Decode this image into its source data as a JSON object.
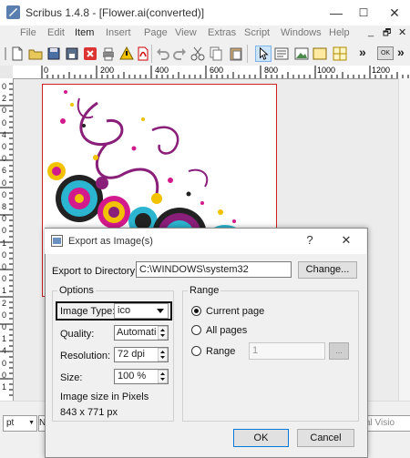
{
  "window": {
    "title": "Scribus 1.4.8 - [Flower.ai(converted)]",
    "controls": {
      "minimize": "—",
      "maximize": "☐",
      "close": "✕"
    }
  },
  "menubar": {
    "items": [
      "File",
      "Edit",
      "Item",
      "Insert",
      "Page",
      "View",
      "Extras",
      "Script",
      "Windows",
      "Help"
    ],
    "child_controls": {
      "minimize": "_",
      "restore": "🗗",
      "close": "✕"
    }
  },
  "toolbar": {
    "more": "»",
    "ok_label": "OK"
  },
  "ruler": {
    "h_labels": [
      "0",
      "200",
      "400",
      "600",
      "800",
      "1000",
      "1200"
    ],
    "v_labels": [
      "0",
      "2",
      "0",
      "0",
      "4",
      "0",
      "0",
      "6",
      "0",
      "0",
      "8",
      "0",
      "0",
      "1",
      "0",
      "0",
      "0",
      "1",
      "2",
      "0",
      "0",
      "1",
      "4",
      "0",
      "0",
      "1"
    ]
  },
  "statusbar": {
    "unit": "pt",
    "unit_arrow": "▼",
    "n_label": "N",
    "visio": "al Visio"
  },
  "dialog": {
    "title": "Export as Image(s)",
    "help": "?",
    "close": "✕",
    "dir_label": "Export to Directory:",
    "dir_value": "C:\\WINDOWS\\system32",
    "change_button": "Change...",
    "options_title": "Options",
    "image_type_label": "Image Type:",
    "image_type_value": "ico",
    "quality_label": "Quality:",
    "quality_value": "Automatic",
    "resolution_label": "Resolution:",
    "resolution_value": "72 dpi",
    "size_label": "Size:",
    "size_value": "100 %",
    "size_pixels_label": "Image size in Pixels",
    "size_pixels_value": "843 x 771 px",
    "range_title": "Range",
    "range_current": "Current page",
    "range_all": "All pages",
    "range_range": "Range",
    "range_value": "1",
    "range_browse": "...",
    "ok_button": "OK",
    "cancel_button": "Cancel"
  }
}
